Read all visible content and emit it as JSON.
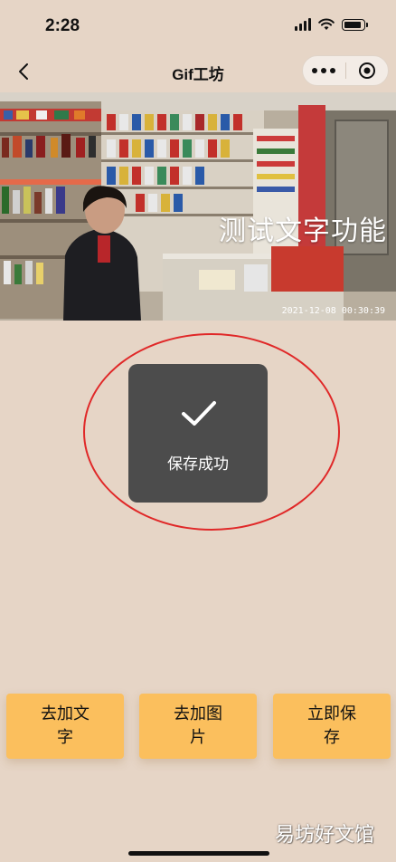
{
  "status_bar": {
    "time": "2:28"
  },
  "nav": {
    "title": "Gif工坊"
  },
  "image": {
    "overlay_text": "测试文字功能",
    "timestamp": "2021-12-08 00:30:39"
  },
  "toast": {
    "label": "保存成功",
    "icon": "checkmark-icon"
  },
  "annotation": {
    "color": "#e02828"
  },
  "buttons": [
    {
      "label": "去加文字"
    },
    {
      "label": "去加图片"
    },
    {
      "label": "立即保存"
    }
  ],
  "watermark": "易坊好文馆",
  "colors": {
    "background": "#e6d5c6",
    "button": "#fbbf5d",
    "toast": "#4c4c4c"
  }
}
